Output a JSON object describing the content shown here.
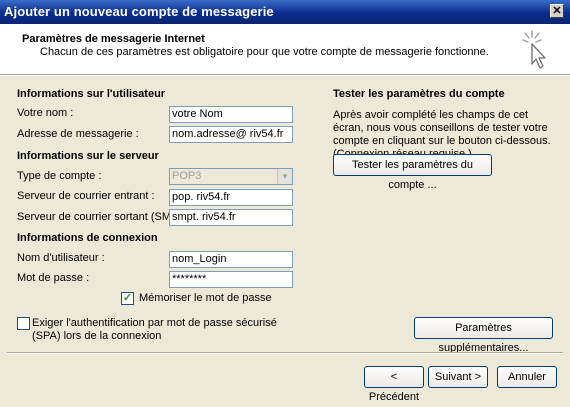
{
  "window": {
    "title": "Ajouter un nouveau compte de messagerie",
    "close_glyph": "✕"
  },
  "header": {
    "title": "Paramètres de messagerie Internet",
    "subtitle": "Chacun de ces paramètres est obligatoire pour que votre compte de messagerie fonctionne.",
    "icon": "cursor-sparkle-icon"
  },
  "user_info": {
    "heading": "Informations sur l'utilisateur",
    "name_label": "Votre nom :",
    "name_value": "votre Nom",
    "email_label": "Adresse de messagerie :",
    "email_value": "nom.adresse@ riv54.fr"
  },
  "server_info": {
    "heading": "Informations sur le serveur",
    "account_type_label": "Type de compte :",
    "account_type_value": "POP3",
    "incoming_label": "Serveur de courrier entrant :",
    "incoming_value": "pop. riv54.fr",
    "outgoing_label": "Serveur de courrier sortant (SMTP) :",
    "outgoing_value": "smpt. riv54.fr"
  },
  "login_info": {
    "heading": "Informations de connexion",
    "username_label": "Nom d'utilisateur :",
    "username_value": "nom_Login",
    "password_label": "Mot de passe :",
    "password_value": "********",
    "remember_label": "Mémoriser le mot de passe",
    "remember_checked": true,
    "spa_label": "Exiger l'authentification par mot de passe sécurisé (SPA) lors de la connexion",
    "spa_checked": false
  },
  "test_panel": {
    "heading": "Tester les paramètres du compte",
    "description": "Après avoir complété les champs de cet écran, nous vous conseillons de tester votre compte en cliquant sur le bouton ci-dessous. (Connexion réseau requise.)",
    "test_button": "Tester les paramètres du compte ..."
  },
  "more_settings_button": "Paramètres supplémentaires...",
  "nav": {
    "back": "< Précédent",
    "next": "Suivant >",
    "cancel": "Annuler"
  },
  "colors": {
    "titlebar": "#0A2C8C",
    "dialog_bg": "#ECE9D8",
    "field_border": "#7F9DB9",
    "check_mark": "#21A121"
  }
}
